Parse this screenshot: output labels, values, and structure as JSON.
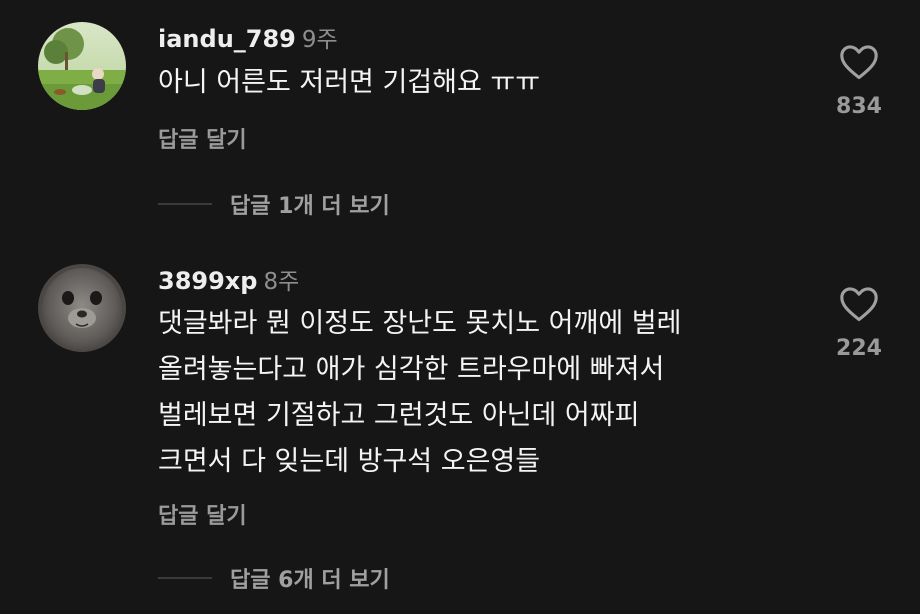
{
  "comments": [
    {
      "username": "iandu_789",
      "time": "9주",
      "lines": [
        "아니 어른도 저러면 기겁해요 ㅠㅠ"
      ],
      "reply_label": "답글 달기",
      "likes": "834",
      "view_replies": "답글 1개 더 보기"
    },
    {
      "username": "3899xp",
      "time": "8주",
      "lines": [
        "댓글봐라 뭔 이정도 장난도 못치노 어깨에 벌레",
        "올려놓는다고 애가 심각한 트라우마에 빠져서",
        "벌레보면 기절하고 그런것도 아닌데 어짜피",
        "크면서 다 잊는데 방구석 오은영들"
      ],
      "reply_label": "답글 달기",
      "likes": "224",
      "view_replies": "답글 6개 더 보기"
    }
  ],
  "colors": {
    "background": "#161616",
    "muted": "#9a9a9a"
  },
  "icons": {
    "like": "heart-outline-icon"
  }
}
